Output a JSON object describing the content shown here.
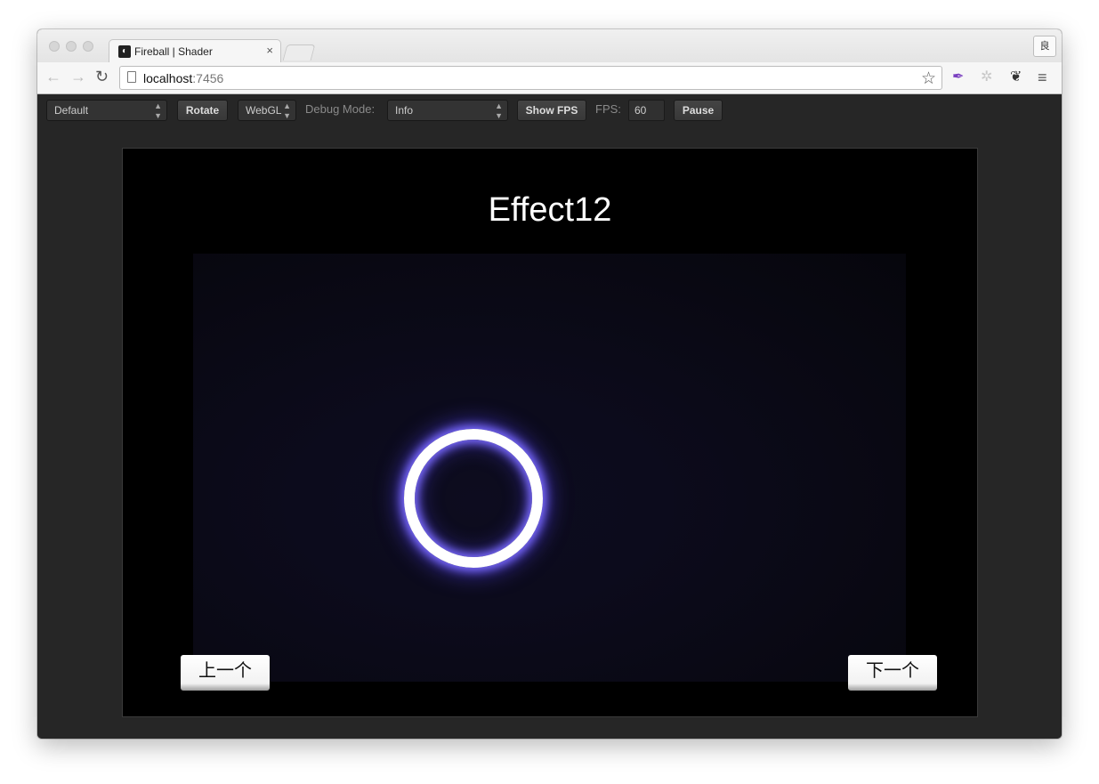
{
  "browser": {
    "tab_title": "Fireball | Shader",
    "tab_close": "×",
    "profile_glyph": "良",
    "url_host": "localhost",
    "url_port": ":7456",
    "back_icon": "arrow-left",
    "forward_icon": "arrow-right",
    "reload_icon": "reload",
    "bookmark_icon": "star",
    "menu_icon": "hamburger"
  },
  "toolbar": {
    "design_select": "Default",
    "rotate_label": "Rotate",
    "renderer_select": "WebGL",
    "debug_mode_label": "Debug Mode:",
    "debug_mode_select": "Info",
    "show_fps_label": "Show FPS",
    "fps_label": "FPS:",
    "fps_value": "60",
    "pause_label": "Pause"
  },
  "game": {
    "title": "Effect12",
    "prev_button": "上一个",
    "next_button": "下一个",
    "ring_color": "#7b6bff"
  }
}
